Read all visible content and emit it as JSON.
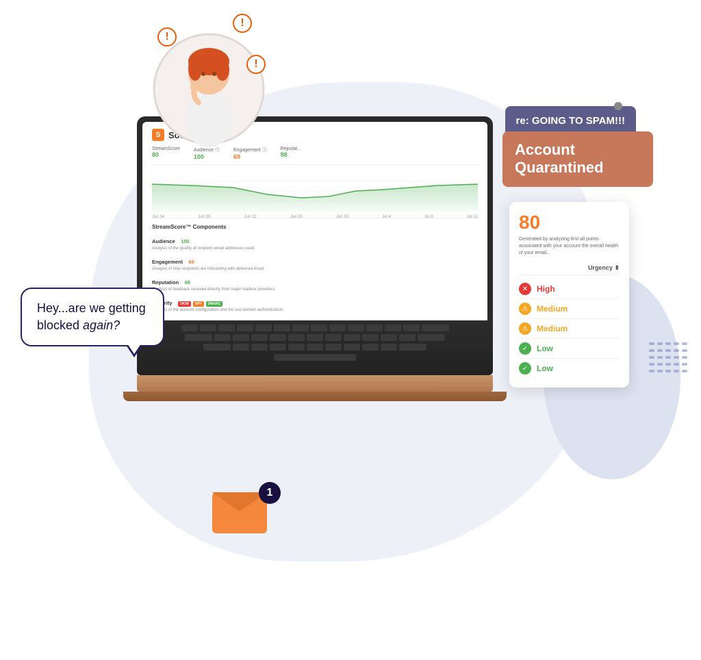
{
  "app": {
    "name": "SocketLabs"
  },
  "illustration": {
    "speech_bubble": {
      "text_normal": "Hey...are we getting blocked ",
      "text_italic": "again?",
      "full_text": "Hey...are we getting blocked again?"
    },
    "spam_card": {
      "text": "re: GOING TO SPAM!!!"
    },
    "quarantined_card": {
      "text": "Account Quarantined"
    }
  },
  "screen": {
    "logo": "SL",
    "logo_text": "SocketLabs",
    "metrics": [
      {
        "label": "StreamScore",
        "value": "80",
        "color": "green"
      },
      {
        "label": "Audience ⓘ",
        "value": "100",
        "color": "green"
      },
      {
        "label": "Engagement ⓘ",
        "value": "69",
        "color": "orange"
      },
      {
        "label": "Reputat...",
        "value": "98",
        "color": "green"
      }
    ],
    "chart_labels": [
      "Jun 14",
      "Jun 19",
      "Jun 22",
      "Jun 25",
      "Jun 30",
      "Jul 4",
      "Jul 8",
      "Jul 12"
    ],
    "components_title": "StreamScore™ Components",
    "components": [
      {
        "name": "Audience",
        "score": "100",
        "score_color": "green",
        "desc": "Analysis of the quality of recipient email addresses used."
      },
      {
        "name": "Engagement",
        "score": "69",
        "score_color": "orange",
        "desc": "Analysis of how recipients are interacting with delivered email."
      },
      {
        "name": "Reputation",
        "score": "98",
        "score_color": "green",
        "desc": "Analysis of feedback received directly from major mailbox providers."
      },
      {
        "name": "Security",
        "score": "",
        "score_color": "green",
        "desc": "Analysis of the account configuration and the use domain authentication.",
        "badges": [
          "DKIM",
          "SPF",
          "DMARC"
        ]
      }
    ]
  },
  "score_card": {
    "score": "80",
    "description": "Generated by analyzing first all points associated with your account the overall health of your email...",
    "urgency_header": "Urgency ⬍",
    "urgency_items": [
      {
        "level": "High",
        "icon_type": "red"
      },
      {
        "level": "Medium",
        "icon_type": "yellow"
      },
      {
        "level": "Medium",
        "icon_type": "yellow"
      },
      {
        "level": "Low",
        "icon_type": "green"
      },
      {
        "level": "Low",
        "icon_type": "green"
      }
    ]
  },
  "notification": {
    "badge_count": "1"
  }
}
